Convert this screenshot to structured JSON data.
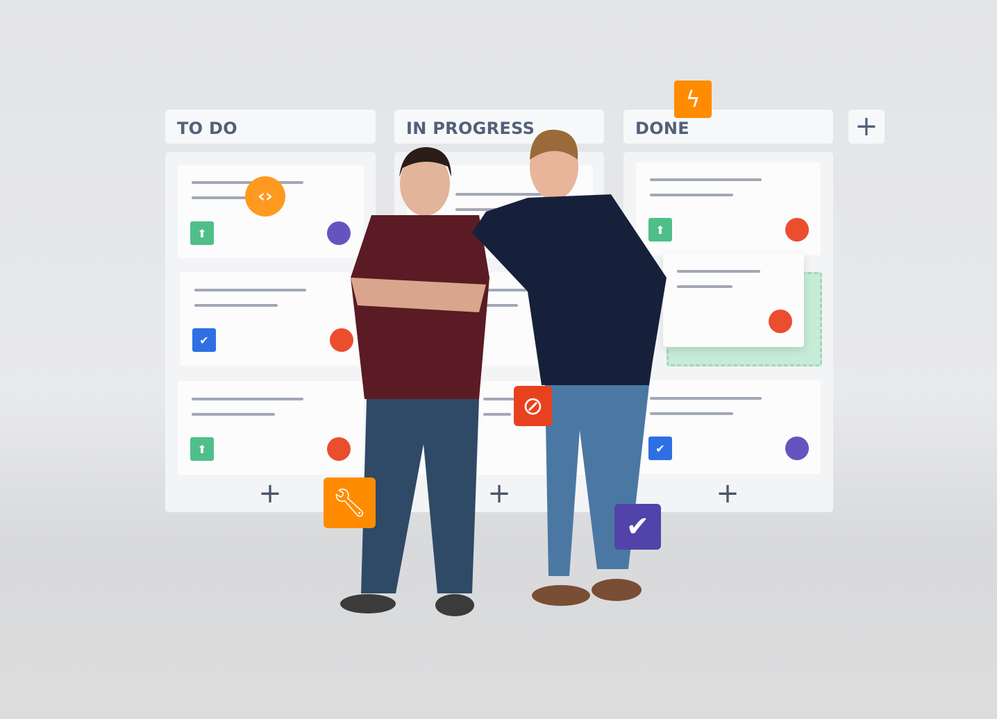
{
  "board": {
    "columns": [
      {
        "title": "TO DO",
        "cards": [
          {
            "icon": "arrow-up-icon",
            "icon_color": "#4fbf8a",
            "dot": "#6554c0"
          },
          {
            "icon": "checkbox-icon",
            "icon_color": "#2f6fe4",
            "dot": "#eb4d2f"
          },
          {
            "icon": "arrow-up-icon",
            "icon_color": "#4fbf8a",
            "dot": "#eb4d2f"
          }
        ]
      },
      {
        "title": "IN PROGRESS"
      },
      {
        "title": "DONE",
        "cards": [
          {
            "icon": "arrow-up-icon",
            "icon_color": "#4fbf8a",
            "dot": "#eb4d2f"
          },
          {
            "icon": "none",
            "dot": "#eb4d2f"
          },
          {
            "icon": "checkbox-icon",
            "icon_color": "#2f6fe4",
            "dot": "#6554c0"
          }
        ]
      }
    ],
    "add_card_label": "+",
    "add_column_label": "+"
  },
  "floating_icons": [
    {
      "name": "lightning-icon",
      "color": "#ff8b00"
    },
    {
      "name": "code-icon",
      "color": "#ff991f"
    },
    {
      "name": "wrench-icon",
      "color": "#ff8b00"
    },
    {
      "name": "blocked-icon",
      "color": "#e8411f"
    },
    {
      "name": "check-icon",
      "color": "#5243aa"
    }
  ]
}
